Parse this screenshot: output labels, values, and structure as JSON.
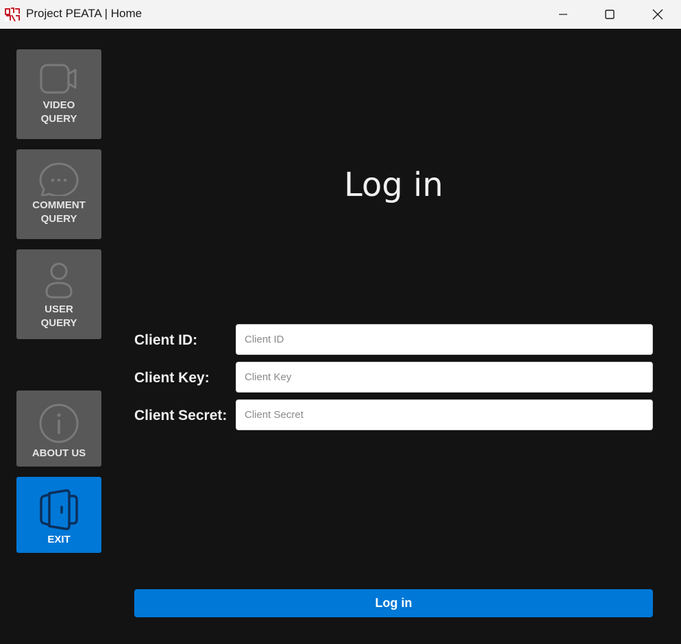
{
  "window": {
    "title": "Project PEATA | Home",
    "app_icon": "peata-logo-icon",
    "controls": [
      "minimize-icon",
      "maximize-icon",
      "close-icon"
    ]
  },
  "sidebar": {
    "items": [
      {
        "label": "VIDEO\nQUERY",
        "icon": "video-camera-icon"
      },
      {
        "label": "COMMENT\nQUERY",
        "icon": "comment-bubble-icon"
      },
      {
        "label": "USER\nQUERY",
        "icon": "user-icon"
      },
      {
        "label": "ABOUT US",
        "icon": "info-icon"
      },
      {
        "label": "EXIT",
        "icon": "exit-door-icon"
      }
    ]
  },
  "main": {
    "heading": "Log in",
    "fields": [
      {
        "label": "Client ID:",
        "value": "",
        "placeholder": "Client ID"
      },
      {
        "label": "Client Key:",
        "value": "",
        "placeholder": "Client Key"
      },
      {
        "label": "Client Secret:",
        "value": "",
        "placeholder": "Client Secret"
      }
    ],
    "submit_label": "Log in"
  },
  "colors": {
    "background": "#131313",
    "sidebar_button": "#585858",
    "accent": "#0078d7",
    "titlebar": "#f3f3f3"
  }
}
